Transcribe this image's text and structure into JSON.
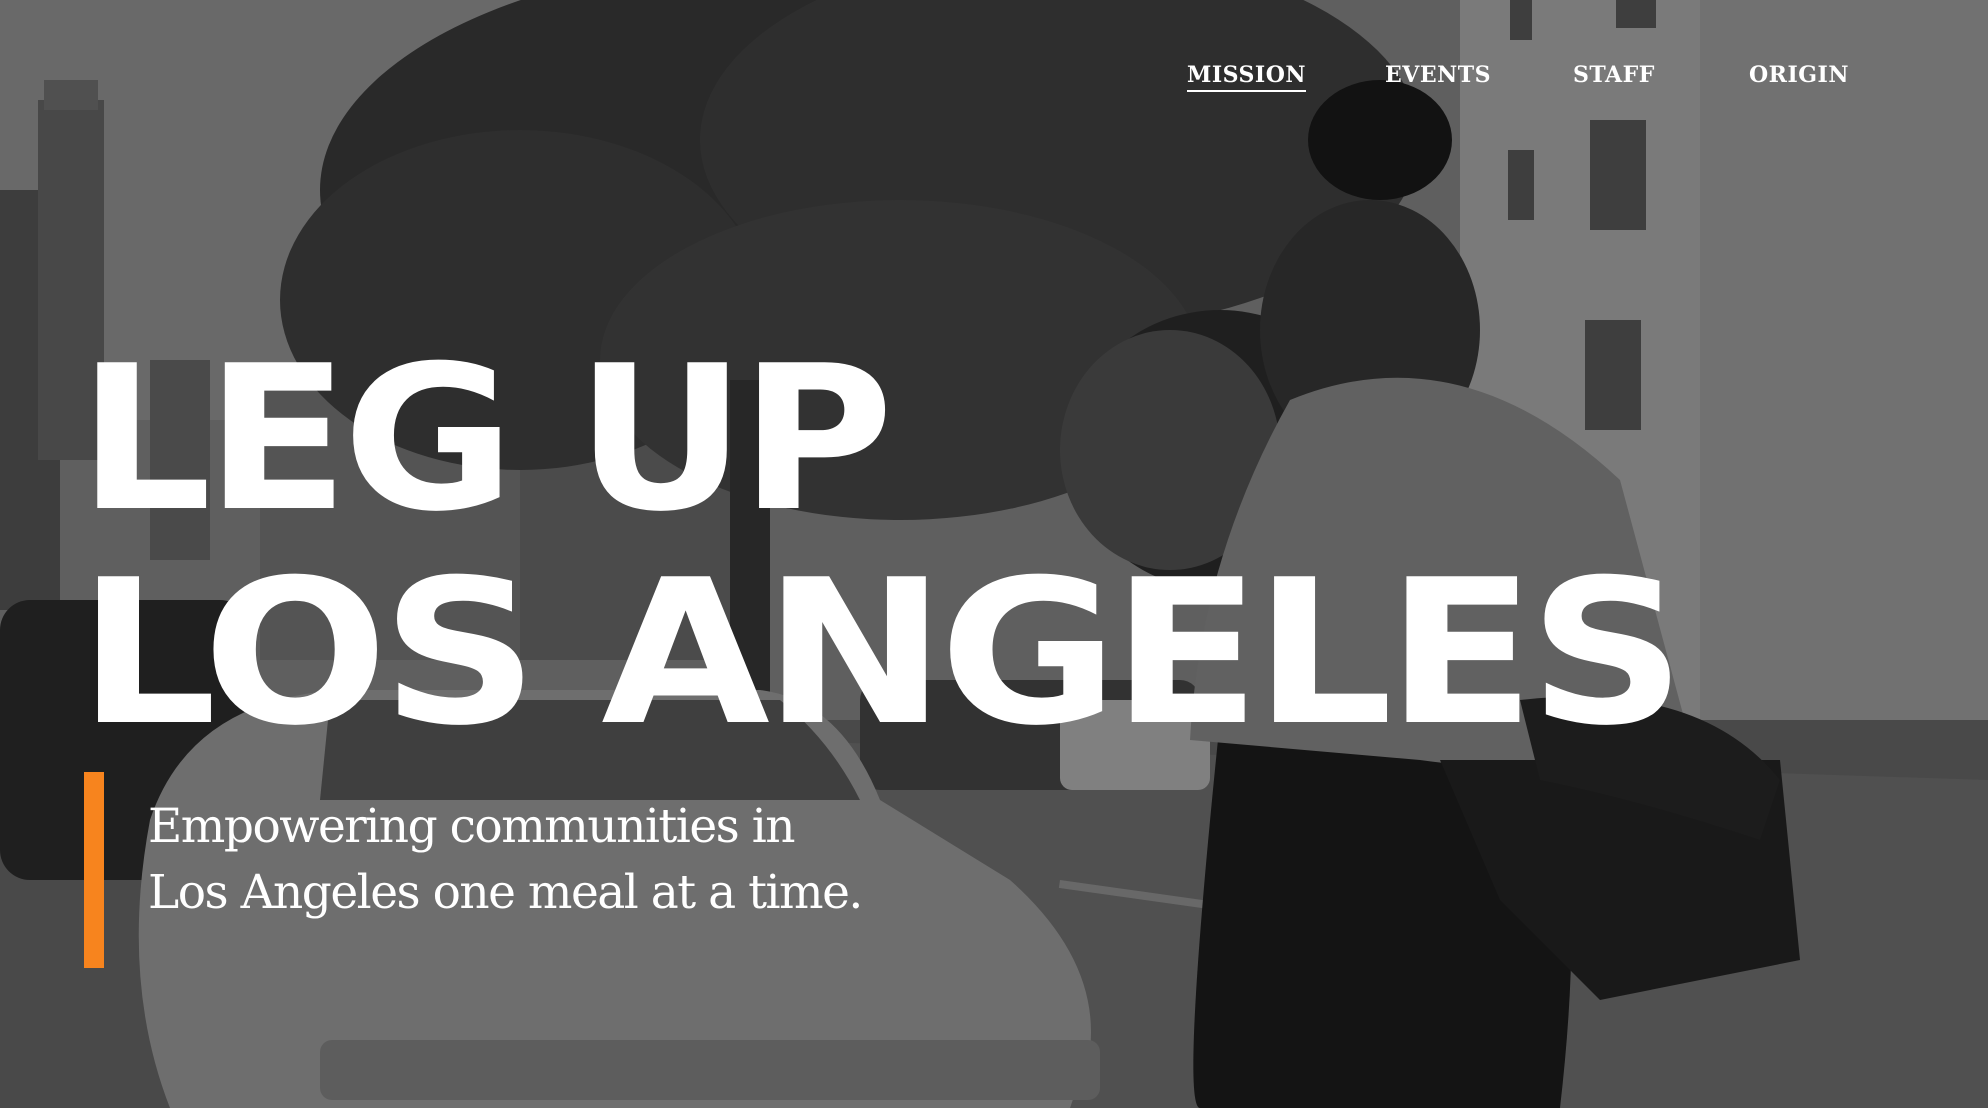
{
  "nav": {
    "items": [
      {
        "label": "MISSION",
        "active": true
      },
      {
        "label": "EVENTS",
        "active": false
      },
      {
        "label": "STAFF",
        "active": false
      },
      {
        "label": "ORIGIN",
        "active": false
      }
    ]
  },
  "hero": {
    "title_line1": "LEG UP",
    "title_line2": "LOS ANGELES",
    "tagline_line1": "Empowering communities in",
    "tagline_line2": "Los Angeles one meal at a time.",
    "accent_color": "#f7841e",
    "photo": "grayscale street photo of man hugging girl, trees, buildings, parked cars"
  }
}
